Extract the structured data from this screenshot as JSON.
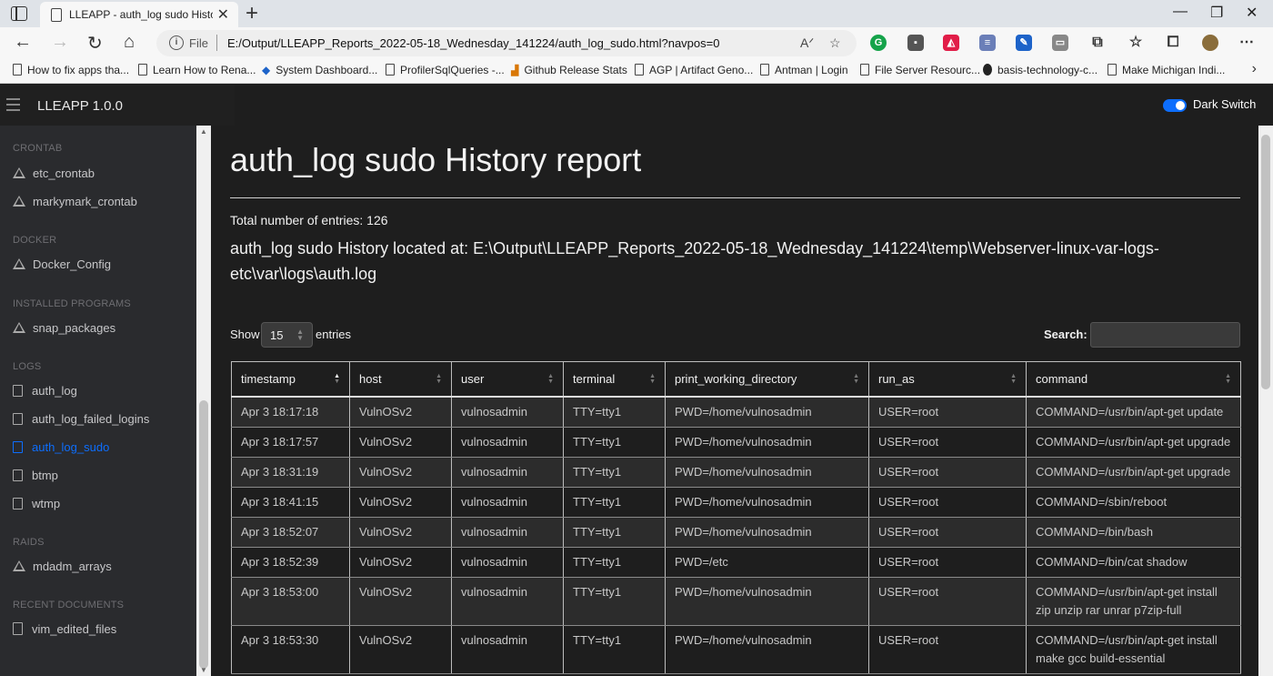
{
  "browser": {
    "tab_title": "LLEAPP - auth_log sudo History report",
    "address_scheme": "File",
    "url": "E:/Output/LLEAPP_Reports_2022-05-18_Wednesday_141224/auth_log_sudo.html?navpos=0",
    "bookmarks": [
      "How to fix apps tha...",
      "Learn How to Rena...",
      "System Dashboard...",
      "ProfilerSqlQueries -...",
      "Github Release Stats",
      "AGP | Artifact Geno...",
      "Antman | Login",
      "File Server Resourc...",
      "basis-technology-c...",
      "Make Michigan Indi..."
    ]
  },
  "app": {
    "brand": "LLEAPP 1.0.0",
    "dark_switch_label": "Dark Switch",
    "dark_switch_on": true
  },
  "sidebar": {
    "sections": [
      {
        "heading": "CRONTAB",
        "items": [
          "etc_crontab",
          "markymark_crontab"
        ]
      },
      {
        "heading": "DOCKER",
        "items": [
          "Docker_Config"
        ]
      },
      {
        "heading": "INSTALLED PROGRAMS",
        "items": [
          "snap_packages"
        ]
      },
      {
        "heading": "LOGS",
        "items": [
          "auth_log",
          "auth_log_failed_logins",
          "auth_log_sudo",
          "btmp",
          "wtmp"
        ]
      },
      {
        "heading": "RAIDS",
        "items": [
          "mdadm_arrays"
        ]
      },
      {
        "heading": "RECENT DOCUMENTS",
        "items": [
          "vim_edited_files"
        ]
      }
    ],
    "active_item": "auth_log_sudo"
  },
  "report": {
    "title": "auth_log sudo History report",
    "total_entries": "Total number of entries: 126",
    "located_at": "auth_log sudo History located at: E:\\Output\\LLEAPP_Reports_2022-05-18_Wednesday_141224\\temp\\Webserver-linux-var-logs-etc\\var\\logs\\auth.log",
    "show_label": "Show",
    "show_value": "15",
    "entries_label": "entries",
    "search_label": "Search:",
    "search_value": "",
    "columns": [
      "timestamp",
      "host",
      "user",
      "terminal",
      "print_working_directory",
      "run_as",
      "command"
    ],
    "sorted_column": "timestamp",
    "rows": [
      [
        "Apr 3 18:17:18",
        "VulnOSv2",
        "vulnosadmin",
        "TTY=tty1",
        "PWD=/home/vulnosadmin",
        "USER=root",
        "COMMAND=/usr/bin/apt-get update"
      ],
      [
        "Apr 3 18:17:57",
        "VulnOSv2",
        "vulnosadmin",
        "TTY=tty1",
        "PWD=/home/vulnosadmin",
        "USER=root",
        "COMMAND=/usr/bin/apt-get upgrade"
      ],
      [
        "Apr 3 18:31:19",
        "VulnOSv2",
        "vulnosadmin",
        "TTY=tty1",
        "PWD=/home/vulnosadmin",
        "USER=root",
        "COMMAND=/usr/bin/apt-get upgrade"
      ],
      [
        "Apr 3 18:41:15",
        "VulnOSv2",
        "vulnosadmin",
        "TTY=tty1",
        "PWD=/home/vulnosadmin",
        "USER=root",
        "COMMAND=/sbin/reboot"
      ],
      [
        "Apr 3 18:52:07",
        "VulnOSv2",
        "vulnosadmin",
        "TTY=tty1",
        "PWD=/home/vulnosadmin",
        "USER=root",
        "COMMAND=/bin/bash"
      ],
      [
        "Apr 3 18:52:39",
        "VulnOSv2",
        "vulnosadmin",
        "TTY=tty1",
        "PWD=/etc",
        "USER=root",
        "COMMAND=/bin/cat shadow"
      ],
      [
        "Apr 3 18:53:00",
        "VulnOSv2",
        "vulnosadmin",
        "TTY=tty1",
        "PWD=/home/vulnosadmin",
        "USER=root",
        "COMMAND=/usr/bin/apt-get install zip unzip rar unrar p7zip-full"
      ],
      [
        "Apr 3 18:53:30",
        "VulnOSv2",
        "vulnosadmin",
        "TTY=tty1",
        "PWD=/home/vulnosadmin",
        "USER=root",
        "COMMAND=/usr/bin/apt-get install make gcc build-essential"
      ]
    ]
  }
}
